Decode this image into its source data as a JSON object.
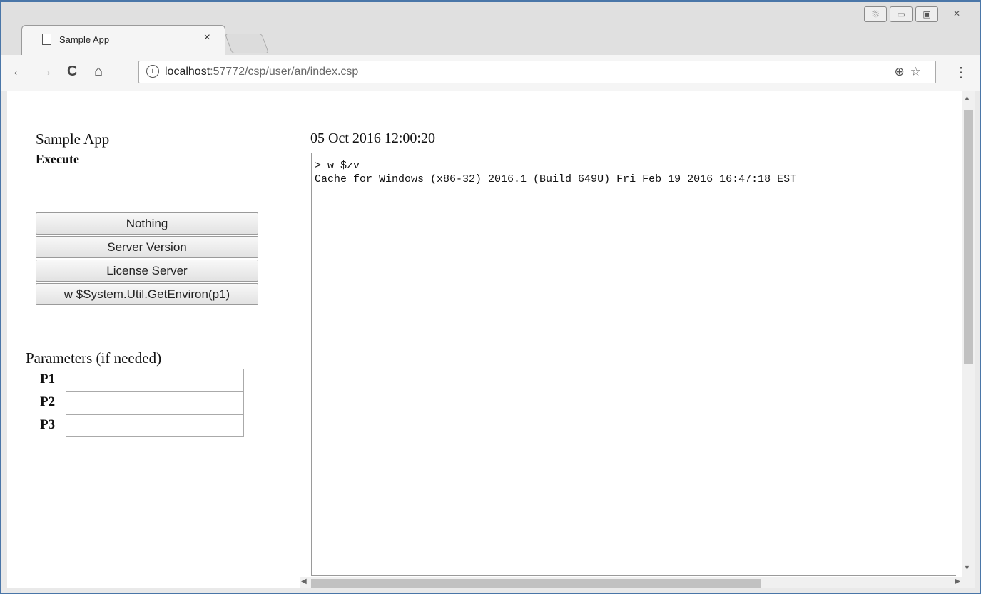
{
  "browser": {
    "tab_title": "Sample App",
    "tab_close": "×",
    "window_buttons": [
      "⛆",
      "▭",
      "▣",
      "✕"
    ],
    "address": {
      "host": "localhost",
      "rest": ":57772/csp/user/an/index.csp",
      "info_glyph": "i",
      "right_icons": "⊕☆"
    },
    "nav": {
      "back": "←",
      "forward": "→",
      "reload": "C",
      "home": "⌂"
    },
    "menu": "⋮"
  },
  "page": {
    "title": "Sample App",
    "execute_label": "Execute",
    "buttons": [
      "Nothing",
      "Server Version",
      "License Server",
      "w $System.Util.GetEnviron(p1)"
    ],
    "params_title": "Parameters (if needed)",
    "params": [
      {
        "label": "P1",
        "value": ""
      },
      {
        "label": "P2",
        "value": ""
      },
      {
        "label": "P3",
        "value": ""
      }
    ],
    "timestamp": "05 Oct 2016 12:00:20",
    "console_lines": [
      "> w $zv",
      "Cache for Windows (x86-32) 2016.1 (Build 649U) Fri Feb 19 2016 16:47:18 EST"
    ]
  }
}
